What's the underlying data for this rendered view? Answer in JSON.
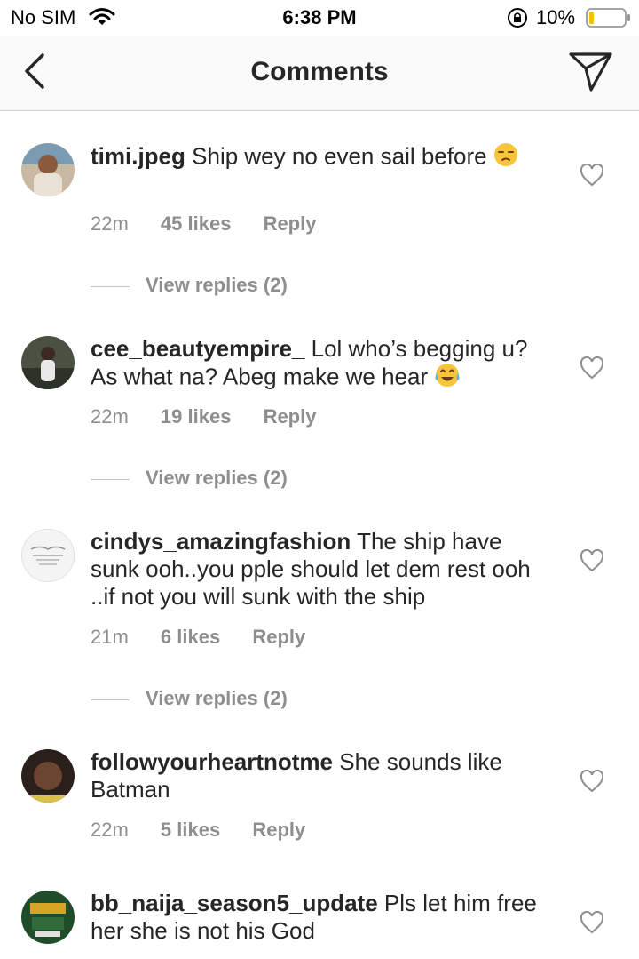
{
  "status_bar": {
    "carrier": "No SIM",
    "time": "6:38 PM",
    "battery": "10%"
  },
  "nav": {
    "title": "Comments",
    "back_icon": "chevron-left-icon",
    "send_icon": "send-icon"
  },
  "comments": [
    {
      "username": "timi.jpeg",
      "text": "Ship wey no even sail before",
      "emoji": "unamused-face-icon",
      "time": "22m",
      "likes": "45 likes",
      "reply": "Reply",
      "view_replies": "View replies (2)"
    },
    {
      "username": "cee_beautyempire_",
      "text": "Lol who’s begging u? As what na? Abeg make we hear",
      "emoji": "tears-of-joy-face-icon",
      "time": "22m",
      "likes": "19 likes",
      "reply": "Reply",
      "view_replies": "View replies (2)"
    },
    {
      "username": "cindys_amazingfashion",
      "text": "The ship have sunk ooh..you pple should let dem rest ooh ..if not you will sunk with the ship",
      "time": "21m",
      "likes": "6 likes",
      "reply": "Reply",
      "view_replies": "View replies (2)"
    },
    {
      "username": "followyourheartnotme",
      "text": "She sounds like Batman",
      "time": "22m",
      "likes": "5 likes",
      "reply": "Reply"
    },
    {
      "username": "bb_naija_season5_update",
      "text": "Pls let him free her she is not his God"
    }
  ],
  "colors": {
    "text": "#262626",
    "meta": "#8e8e8e",
    "divider": "#cfcfcf"
  }
}
